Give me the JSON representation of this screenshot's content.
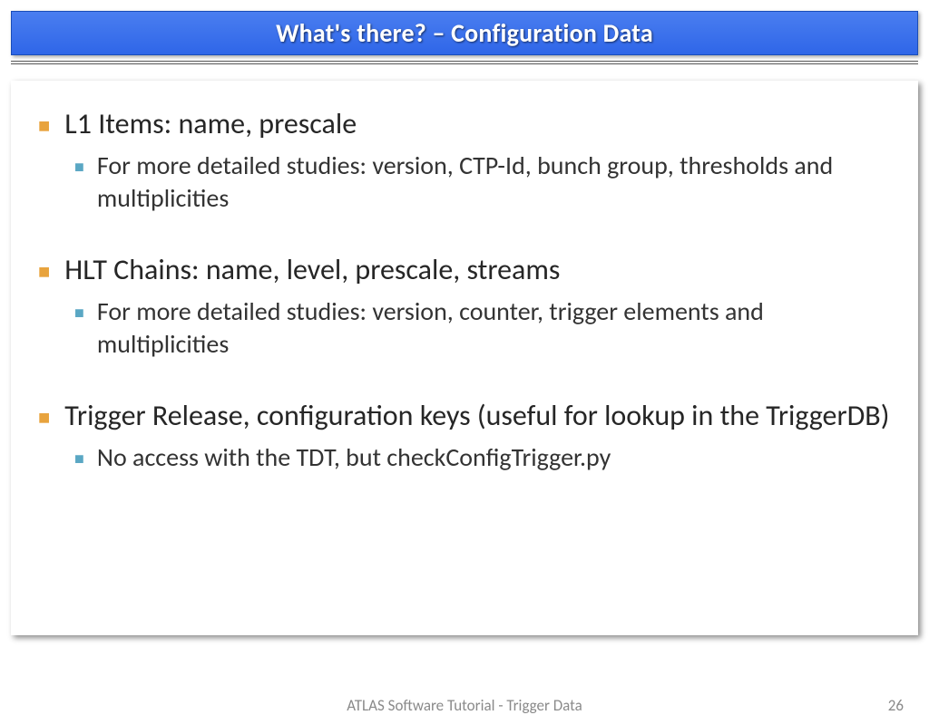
{
  "title": "What's there? – Configuration Data",
  "items": [
    {
      "main": "L1 Items: name, prescale",
      "sub": "For more detailed studies: version, CTP-Id, bunch group, thresholds and multiplicities"
    },
    {
      "main": "HLT Chains: name, level, prescale, streams",
      "sub": "For more detailed studies: version, counter, trigger elements and multiplicities"
    },
    {
      "main": "Trigger Release, configuration keys (useful for lookup in the TriggerDB)",
      "sub": "No access with the TDT, but checkConfigTrigger.py"
    }
  ],
  "footer": {
    "text": "ATLAS Software Tutorial - Trigger Data",
    "page": "26"
  }
}
